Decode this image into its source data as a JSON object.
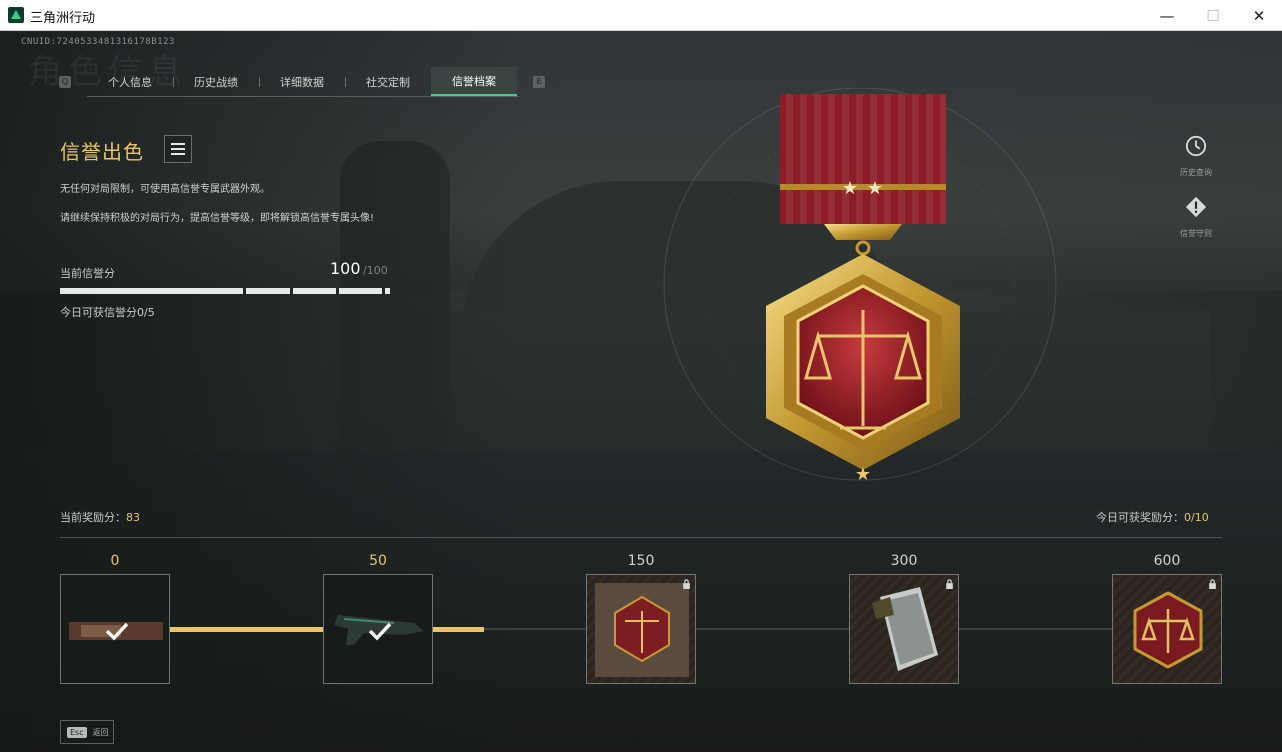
{
  "window": {
    "title": "三角洲行动",
    "minimize": "—",
    "maximize": "☐",
    "close": "✕"
  },
  "header": {
    "cnuid": "CNUID:7240533481316178B123",
    "ghost_title": "角色信息"
  },
  "tabs": [
    {
      "label": "个人信息"
    },
    {
      "label": "历史战绩"
    },
    {
      "label": "详细数据"
    },
    {
      "label": "社交定制"
    },
    {
      "label": "信誉档案",
      "active": true
    }
  ],
  "tab_keys": {
    "prev": "Q",
    "next": "E"
  },
  "reputation": {
    "title": "信誉出色",
    "desc1": "无任何对局限制，可使用高信誉专属武器外观。",
    "desc2": "请继续保持积极的对局行为，提高信誉等级，即将解锁高信誉专属头像!",
    "score_label": "当前信誉分",
    "score": "100",
    "score_max": "/100",
    "daily": "今日可获信誉分0/5"
  },
  "side": {
    "history": "历史查询",
    "rules": "信誉守则"
  },
  "rewards": {
    "current_label": "当前奖励分：",
    "current_value": "83",
    "today_label": "今日可获奖励分：",
    "today_value": "0/10",
    "milestones": [
      {
        "value": "0",
        "state": "done"
      },
      {
        "value": "50",
        "state": "done"
      },
      {
        "value": "150",
        "state": "locked"
      },
      {
        "value": "300",
        "state": "locked"
      },
      {
        "value": "600",
        "state": "locked"
      }
    ]
  },
  "footer": {
    "esc_key": "Esc",
    "esc_label": "返回"
  },
  "colors": {
    "accent_gold": "#e9c56a",
    "tab_active": "#3fd08f"
  }
}
